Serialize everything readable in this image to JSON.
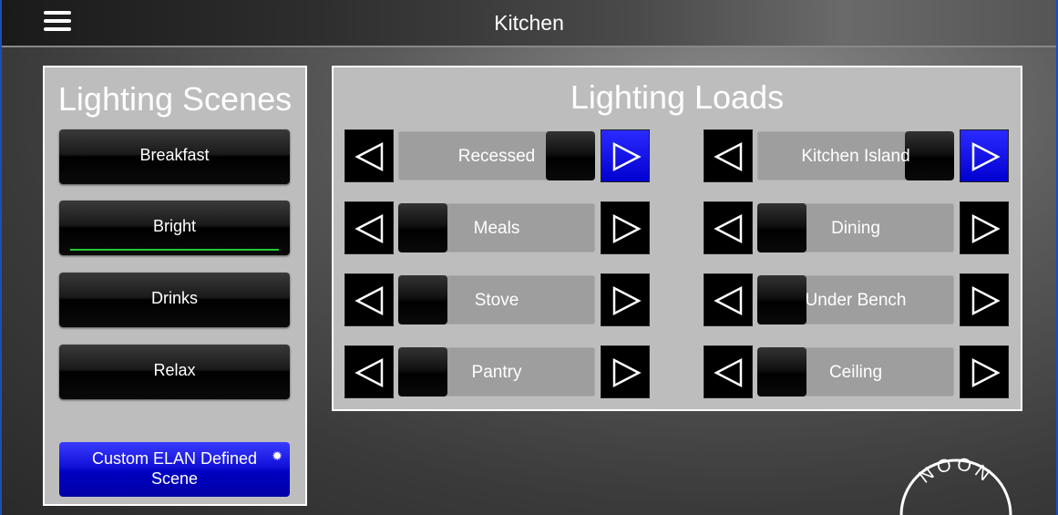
{
  "header": {
    "title": "Kitchen"
  },
  "scenes": {
    "title": "Lighting Scenes",
    "items": [
      {
        "label": "Breakfast",
        "active": false
      },
      {
        "label": "Bright",
        "active": true
      },
      {
        "label": "Drinks",
        "active": false
      },
      {
        "label": "Relax",
        "active": false
      }
    ],
    "custom": {
      "line1": "Custom ELAN Defined",
      "line2": "Scene"
    }
  },
  "loads": {
    "title": "Lighting Loads",
    "items": [
      {
        "label": "Recessed",
        "level": 1.0,
        "on": true
      },
      {
        "label": "Kitchen Island",
        "level": 1.0,
        "on": true
      },
      {
        "label": "Meals",
        "level": 0,
        "on": false
      },
      {
        "label": "Dining",
        "level": 0,
        "on": false
      },
      {
        "label": "Stove",
        "level": 0,
        "on": false
      },
      {
        "label": "Under Bench",
        "level": 0,
        "on": false
      },
      {
        "label": "Pantry",
        "level": 0,
        "on": false
      },
      {
        "label": "Ceiling",
        "level": 0,
        "on": false
      }
    ]
  },
  "brand": {
    "logo_text": "NOON"
  },
  "colors": {
    "accent_on": "#0000d0",
    "active_indicator": "#22cc33",
    "frame": "#1c4fb5"
  }
}
